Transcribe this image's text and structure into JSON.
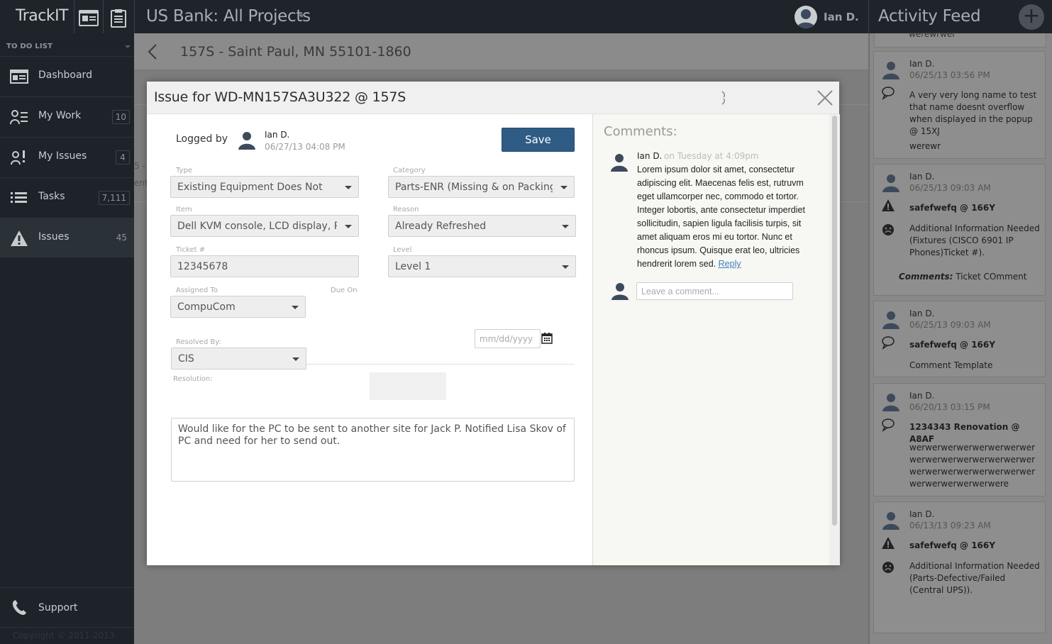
{
  "app": {
    "logo": "TrackIT",
    "project_title": "US Bank: All Projects",
    "user_name": "Ian D.",
    "feed_title": "Activity Feed",
    "add_label": "+"
  },
  "sidebar": {
    "heading": "TO DO LIST",
    "items": [
      {
        "label": "Dashboard",
        "count": "",
        "icon": "dashboard-icon"
      },
      {
        "label": "My Work",
        "count": "10",
        "icon": "my-work-icon"
      },
      {
        "label": "My Issues",
        "count": "4",
        "icon": "my-issues-icon"
      },
      {
        "label": "Tasks",
        "count": "7,111",
        "icon": "tasks-icon"
      },
      {
        "label": "Issues",
        "count": "45",
        "icon": "warning-icon"
      }
    ],
    "support_label": "Support",
    "copyright": "Copyright © 2011-2013"
  },
  "page": {
    "site_title": "157S - Saint Paul, MN 55101-1860",
    "ghost1": "5 -",
    "ghost2": "ent"
  },
  "modal": {
    "title": "Issue for WD-MN157SA3U322 @ 157S",
    "logged_by_label": "Logged by",
    "logged_by_name": "Ian D.",
    "logged_by_date": "06/27/13 04:08 PM",
    "save_label": "Save",
    "fields": {
      "type_label": "Type",
      "type_value": "Existing Equipment Does Not",
      "category_label": "Category",
      "category_value": "Parts-ENR (Missing & on Packing",
      "item_label": "Item",
      "item_value": "Dell KVM console, LCD display, P...",
      "reason_label": "Reason",
      "reason_value": "Already Refreshed",
      "ticket_label": "Ticket #",
      "ticket_value": "12345678",
      "level_label": "Level",
      "level_value": "Level 1",
      "assigned_label": "Assigned To",
      "assigned_value": "CompuCom",
      "due_label": "Due On",
      "due_placeholder": "mm/dd/yyyy",
      "resolved_label": "Resolved By:",
      "resolved_value": "CIS",
      "resolution_label": "Resolution:",
      "resolution_value": "Would like for the PC to be sent to another site for Jack P. Notified Lisa Skov of PC and need for her to send out."
    },
    "comments": {
      "title": "Comments:",
      "author": "Ian D.",
      "when": "on Tuesday at 4:09pm",
      "body": "Lorem ipsum dolor sit amet, consectetur adipiscing elit. Maecenas felis est, rutruvm eget ullamcorper nec, commodo et tortor. Integer lobortis, ante consectetur imperdiet sollicitudin, sapien ligula facilisis turpis, sit amet aliquam eros mi eu tortor. Nunc et rhoncus ipsum. Quisque erat leo, ultricies hendrerit lorem sed.",
      "reply_label": "Reply",
      "input_placeholder": "Leave a comment..."
    }
  },
  "feed": {
    "top_stub": "werewrwer",
    "cards": [
      {
        "name": "Ian D.",
        "date": "06/25/13 03:56 PM",
        "icon": "comment-icon",
        "text": "A very very long name to test that name doesnt overflow when displayed in the popup @ 15XJ",
        "sub": "werewr"
      },
      {
        "name": "Ian D.",
        "date": "06/25/13 09:03 AM",
        "icon": "warning-icon",
        "text": "safefwefq @ 166Y",
        "status_icon": "frown-icon",
        "sub": "Additional Information Needed (Fixtures (CISCO 6901 IP Phones)Ticket #).",
        "comment_label": "Comments:",
        "comment_text": " Ticket COmment"
      },
      {
        "name": "Ian D.",
        "date": "06/25/13 09:03 AM",
        "icon": "comment-icon",
        "text": "safefwefq @ 166Y",
        "sub": "Comment Template"
      },
      {
        "name": "Ian D.",
        "date": "06/20/13 03:15 PM",
        "icon": "comment-icon",
        "text": "1234343 Renovation @ A8AF",
        "sub": "werwerwerwerwerwerwerwerwerwerwerwerwerwerwerwerwerwerwerwerwerwerwerwerwerwerwerwerwerwere"
      },
      {
        "name": "Ian D.",
        "date": "06/13/13 09:23 AM",
        "icon": "warning-icon",
        "text": "safefwefq @ 166Y",
        "status_icon": "frown-icon",
        "sub": "Additional Information Needed (Parts-Defective/Failed (Central UPS))."
      }
    ]
  }
}
